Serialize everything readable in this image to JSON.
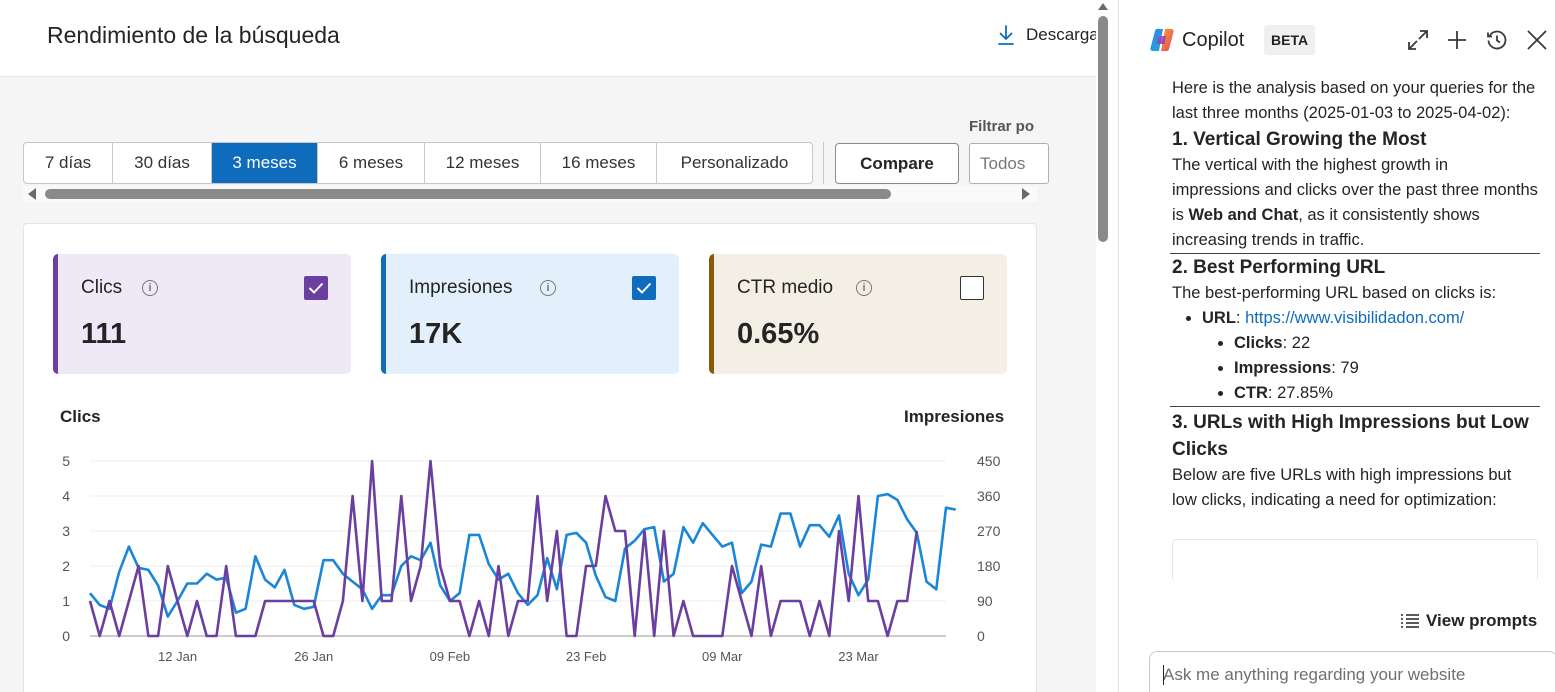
{
  "main": {
    "title": "Rendimiento de la búsqueda",
    "download_label": "Descarga",
    "filter_label": "Filtrar po",
    "date_ranges": [
      {
        "label": "7 días",
        "active": false
      },
      {
        "label": "30 días",
        "active": false
      },
      {
        "label": "3 meses",
        "active": true
      },
      {
        "label": "6 meses",
        "active": false
      },
      {
        "label": "12 meses",
        "active": false
      },
      {
        "label": "16 meses",
        "active": false
      },
      {
        "label": "Personalizado",
        "active": false
      }
    ],
    "compare_label": "Compare",
    "filter_value": "Todos",
    "metrics": [
      {
        "name": "Clics",
        "value": "111",
        "checked": true,
        "color": "#6b3fa0",
        "info_icon": "info-icon"
      },
      {
        "name": "Impresiones",
        "value": "17K",
        "checked": true,
        "color": "#0f6cbd",
        "info_icon": "info-icon"
      },
      {
        "name": "CTR medio",
        "value": "0.65%",
        "checked": false,
        "color": "#8a5a0a",
        "info_icon": "info-icon"
      }
    ],
    "chart_left_title": "Clics",
    "chart_right_title": "Impresiones"
  },
  "chart_data": {
    "type": "line",
    "xlabel": "",
    "ylabel": "Clics",
    "y2label": "Impresiones",
    "ylim": [
      0,
      5
    ],
    "y2lim": [
      0,
      450
    ],
    "yticks": [
      "0",
      "1",
      "2",
      "3",
      "4",
      "5"
    ],
    "y2ticks": [
      "0",
      "90",
      "180",
      "270",
      "360",
      "450"
    ],
    "x_tick_labels": [
      "12 Jan",
      "26 Jan",
      "09 Feb",
      "23 Feb",
      "09 Mar",
      "23 Mar"
    ],
    "x_tick_positions": [
      9,
      23,
      37,
      51,
      65,
      79
    ],
    "x_range": [
      0,
      88
    ],
    "grid": true,
    "series": [
      {
        "name": "Clics",
        "axis": "left",
        "color": "#6b3fa0",
        "values": [
          1,
          0,
          1,
          0,
          1,
          2,
          0,
          0,
          2,
          1,
          0,
          1,
          0,
          0,
          2,
          0,
          0,
          0,
          1,
          1,
          1,
          1,
          1,
          1,
          0,
          0,
          1,
          4,
          1,
          5,
          1,
          1,
          4,
          1,
          2,
          5,
          2,
          1,
          1,
          0,
          1,
          0,
          2,
          0,
          1,
          1,
          4,
          1,
          3,
          0,
          0,
          2,
          2,
          4,
          3,
          3,
          0,
          3,
          0,
          3,
          0,
          1,
          0,
          0,
          0,
          0,
          2,
          1,
          0,
          2,
          0,
          1,
          1,
          1,
          0,
          1,
          0,
          3,
          1,
          4,
          1,
          1,
          0,
          1,
          1,
          3
        ]
      },
      {
        "name": "Impresiones",
        "axis": "right",
        "color": "#1a86d8",
        "values": [
          110,
          80,
          70,
          165,
          230,
          175,
          170,
          130,
          50,
          90,
          135,
          135,
          160,
          145,
          150,
          60,
          70,
          205,
          145,
          125,
          170,
          80,
          70,
          75,
          195,
          195,
          160,
          140,
          120,
          70,
          105,
          105,
          180,
          205,
          195,
          240,
          130,
          90,
          110,
          260,
          260,
          185,
          145,
          160,
          110,
          80,
          105,
          200,
          120,
          260,
          265,
          240,
          155,
          100,
          90,
          225,
          245,
          275,
          280,
          140,
          160,
          280,
          240,
          290,
          260,
          230,
          240,
          110,
          140,
          235,
          230,
          315,
          315,
          230,
          285,
          285,
          255,
          310,
          160,
          105,
          145,
          360,
          365,
          350,
          300,
          265,
          140,
          120,
          330,
          325
        ],
        "note": "daily values read approximately from the plotted line"
      }
    ]
  },
  "copilot": {
    "title": "Copilot",
    "badge": "BETA",
    "header_icons": [
      "expand-icon",
      "new-chat-icon",
      "history-icon",
      "close-icon"
    ],
    "intro": "Here is the analysis based on your queries for the last three months (2025-01-03 to 2025-04-02):",
    "section1_title": "1. Vertical Growing the Most",
    "section1_text_a": "The vertical with the highest growth in impressions and clicks over the past three months is ",
    "section1_bold": "Web and Chat",
    "section1_text_b": ", as it consistently shows increasing trends in traffic.",
    "section2_title": "2. Best Performing URL",
    "section2_text": "The best-performing URL based on clicks is:",
    "url_label": "URL",
    "url_value": "https://www.visibilidadon.com/",
    "clicks_label": "Clicks",
    "clicks_value": ": 22",
    "impressions_label": "Impressions",
    "impressions_value": ": 79",
    "ctr_label": "CTR",
    "ctr_value": ": 27.85%",
    "section3_title": "3. URLs with High Impressions but Low Clicks",
    "section3_text": "Below are five URLs with high impressions but low clicks, indicating a need for optimization:",
    "view_prompts_label": "View prompts",
    "ask_placeholder": "Ask me anything regarding your website"
  }
}
